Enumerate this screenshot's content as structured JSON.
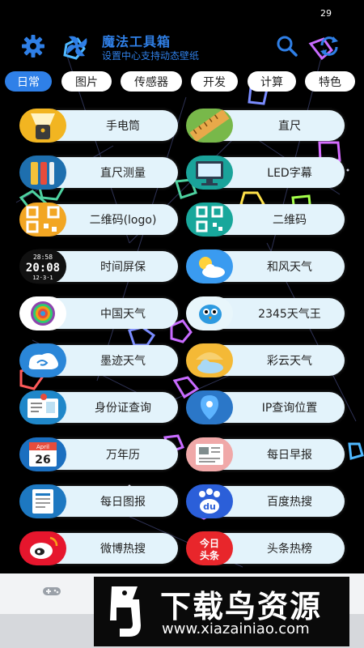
{
  "status": {
    "time": "29"
  },
  "header": {
    "title": "魔法工具箱",
    "subtitle": "设置中心支持动态壁纸",
    "accent": "#2f7fe6"
  },
  "tabs": [
    {
      "label": "日常",
      "active": true
    },
    {
      "label": "图片"
    },
    {
      "label": "传感器"
    },
    {
      "label": "开发"
    },
    {
      "label": "计算"
    },
    {
      "label": "特色"
    }
  ],
  "tools": [
    {
      "label": "手电筒",
      "icon": "flashlight-icon"
    },
    {
      "label": "直尺",
      "icon": "ruler-icon"
    },
    {
      "label": "直尺测量",
      "icon": "tape-measure-icon"
    },
    {
      "label": "LED字幕",
      "icon": "monitor-icon"
    },
    {
      "label": "二维码(logo)",
      "icon": "qr-logo-icon"
    },
    {
      "label": "二维码",
      "icon": "qr-icon"
    },
    {
      "label": "时间屏保",
      "icon": "clock-icon"
    },
    {
      "label": "和风天气",
      "icon": "sun-cloud-icon"
    },
    {
      "label": "中国天气",
      "icon": "rainbow-icon"
    },
    {
      "label": "2345天气王",
      "icon": "bird-weather-icon"
    },
    {
      "label": "墨迹天气",
      "icon": "cloud-swirl-icon"
    },
    {
      "label": "彩云天气",
      "icon": "umbrella-cloud-icon"
    },
    {
      "label": "身份证查询",
      "icon": "id-card-icon"
    },
    {
      "label": "IP查询位置",
      "icon": "location-pin-icon"
    },
    {
      "label": "万年历",
      "icon": "calendar-icon"
    },
    {
      "label": "每日早报",
      "icon": "newspaper-icon"
    },
    {
      "label": "每日图报",
      "icon": "document-icon"
    },
    {
      "label": "百度热搜",
      "icon": "baidu-paw-icon"
    },
    {
      "label": "微博热搜",
      "icon": "weibo-icon"
    },
    {
      "label": "头条热榜",
      "icon": "toutiao-icon"
    }
  ],
  "icon_text": {
    "clock_seconds": "28:58",
    "clock_time": "20:08",
    "clock_date": "12·3·1",
    "calendar_month": "April",
    "calendar_day": "26",
    "baidu": "du",
    "toutiao_line1": "今日",
    "toutiao_line2": "头条"
  },
  "watermark": {
    "title": "下载鸟资源",
    "url": "www.xiazainiao.com"
  }
}
